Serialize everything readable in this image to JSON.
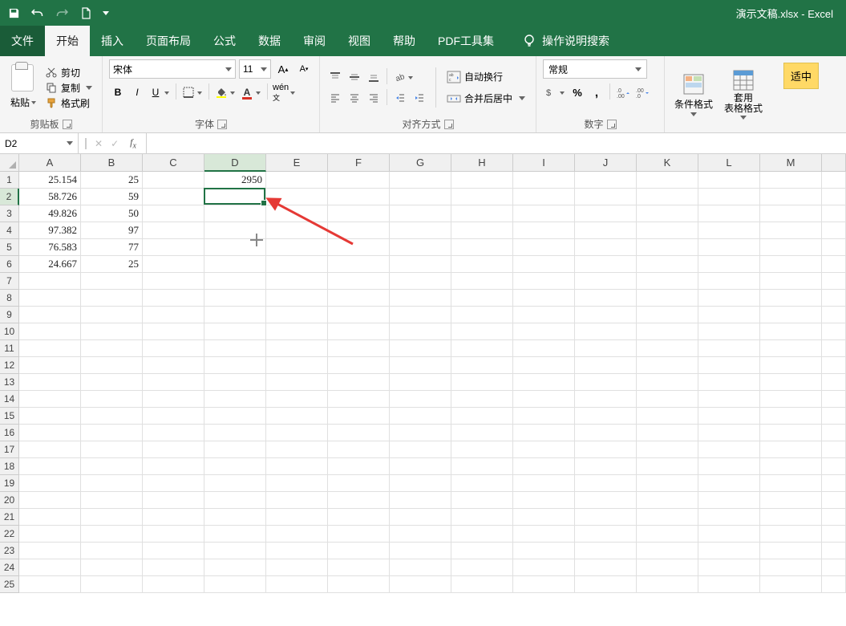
{
  "title": "演示文稿.xlsx - Excel",
  "tabs": {
    "file": "文件",
    "home": "开始",
    "insert": "插入",
    "layout": "页面布局",
    "formula": "公式",
    "data": "数据",
    "review": "审阅",
    "view": "视图",
    "help": "帮助",
    "pdf": "PDF工具集",
    "tell_me": "操作说明搜索"
  },
  "ribbon": {
    "clipboard": {
      "paste": "粘贴",
      "cut": "剪切",
      "copy": "复制",
      "format_painter": "格式刷",
      "label": "剪贴板"
    },
    "font": {
      "name": "宋体",
      "size": "11",
      "label": "字体"
    },
    "alignment": {
      "wrap": "自动换行",
      "merge": "合并后居中",
      "label": "对齐方式"
    },
    "number": {
      "format": "常规",
      "label": "数字"
    },
    "styles": {
      "cond_fmt": "条件格式",
      "table_fmt": "套用\n表格格式",
      "cell_style": "适中"
    }
  },
  "namebox": "D2",
  "formula": "",
  "columns": [
    "A",
    "B",
    "C",
    "D",
    "E",
    "F",
    "G",
    "H",
    "I",
    "J",
    "K",
    "L",
    "M"
  ],
  "rows": 25,
  "selected_col": "D",
  "selected_row": 2,
  "cells": {
    "A1": "25.154",
    "B1": "25",
    "D1": "2950",
    "A2": "58.726",
    "B2": "59",
    "A3": "49.826",
    "B3": "50",
    "A4": "97.382",
    "B4": "97",
    "A5": "76.583",
    "B5": "77",
    "A6": "24.667",
    "B6": "25"
  }
}
